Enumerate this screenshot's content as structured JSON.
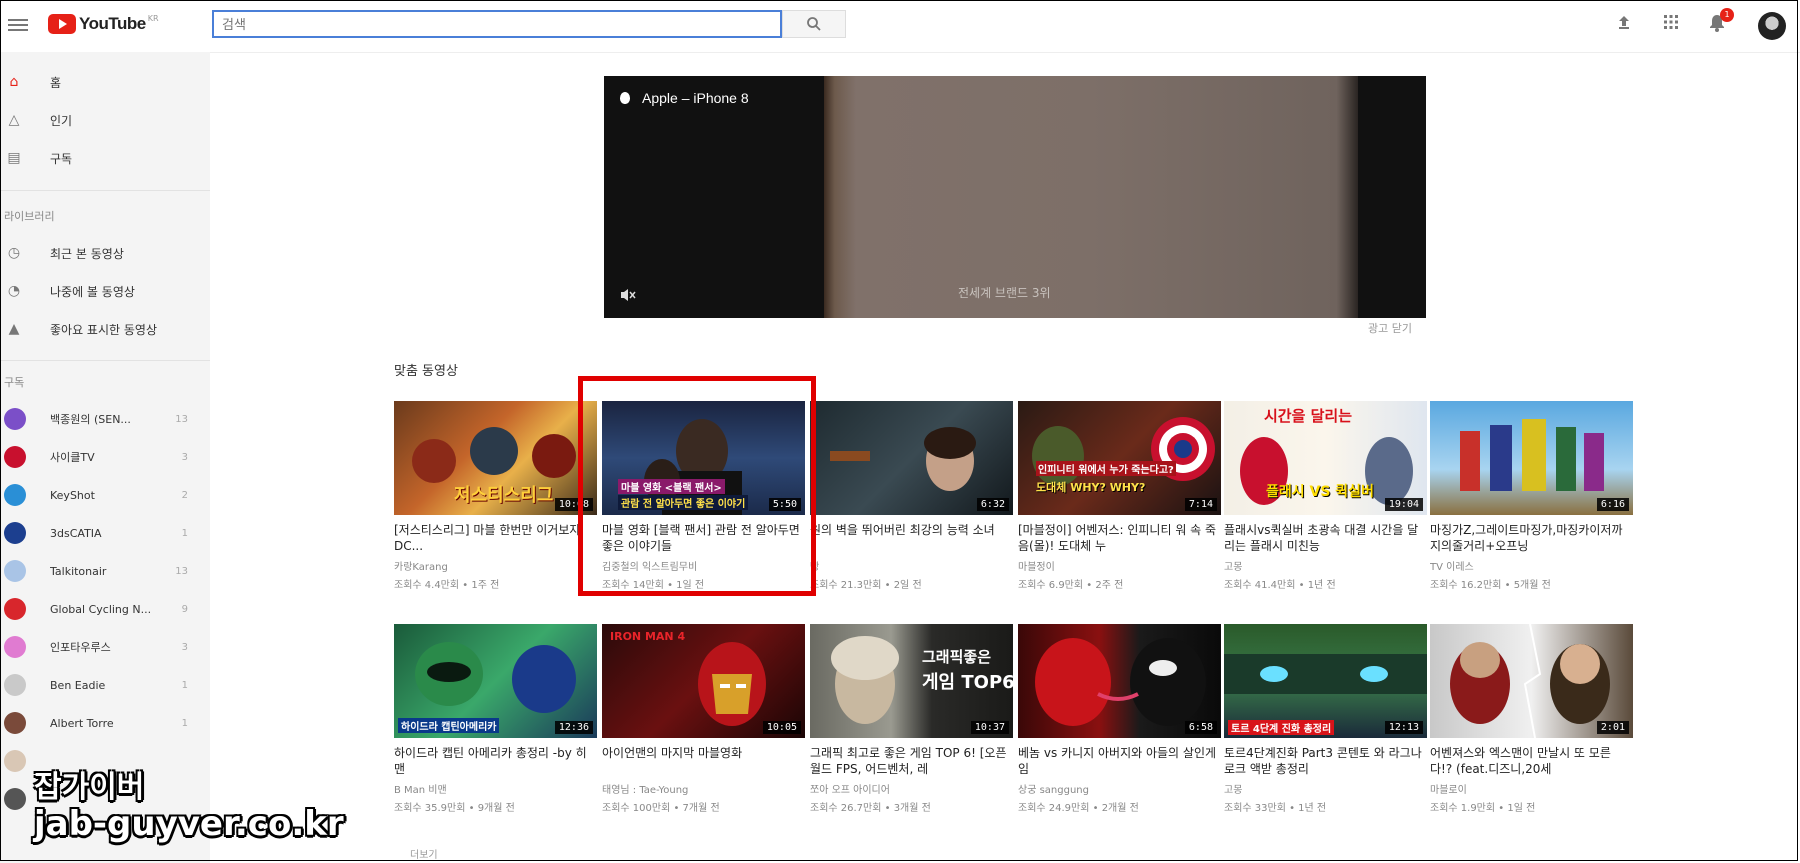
{
  "header": {
    "logo_text": "YouTube",
    "logo_sup": "KR",
    "search_placeholder": "검색",
    "notification_count": "1"
  },
  "sidebar": {
    "main_items": [
      {
        "label": "홈",
        "icon": "home-icon"
      },
      {
        "label": "인기",
        "icon": "fire-icon"
      },
      {
        "label": "구독",
        "icon": "subscriptions-icon"
      }
    ],
    "library_title": "라이브러리",
    "library_items": [
      {
        "label": "최근 본 동영상",
        "icon": "history-icon"
      },
      {
        "label": "나중에 볼 동영상",
        "icon": "clock-icon"
      },
      {
        "label": "좋아요 표시한 동영상",
        "icon": "thumbs-up-icon"
      }
    ],
    "subs_title": "구독",
    "subscriptions": [
      {
        "name": "백종원의 (SEN...",
        "count": "13",
        "color": "#7b4fc8"
      },
      {
        "name": "사이클TV",
        "count": "3",
        "color": "#c8102e"
      },
      {
        "name": "KeyShot",
        "count": "2",
        "color": "#2a8fd6"
      },
      {
        "name": "3dsCATIA",
        "count": "1",
        "color": "#1c3f8f"
      },
      {
        "name": "Talkitonair",
        "count": "13",
        "color": "#a9c4e6"
      },
      {
        "name": "Global Cycling N...",
        "count": "9",
        "color": "#d8262c"
      },
      {
        "name": "인포타우루스",
        "count": "3",
        "color": "#e07bd1"
      },
      {
        "name": "Ben Eadie",
        "count": "1",
        "color": "#c9c9c9"
      },
      {
        "name": "Albert Torre",
        "count": "1",
        "color": "#7a4a3a"
      }
    ]
  },
  "ad": {
    "title": "Apple – iPhone 8",
    "caption": "전세계 브랜드 3위",
    "close_label": "광고 닫기"
  },
  "recommended": {
    "heading": "맞춤 동영상",
    "more_label": "더보기",
    "rows": [
      [
        {
          "title": "[저스티스리그] 마블 한번만 이거보자 DC...",
          "channel": "카랑Karang",
          "meta": "조회수 4.4만회 • 1주 전",
          "duration": "10:08"
        },
        {
          "title": "마블 영화 [블랙 팬서] 관람 전 알아두면 좋은 이야기들",
          "channel": "김중철의 익스트림무비",
          "meta": "조회수 14만회 • 1일 전",
          "duration": "5:50"
        },
        {
          "title": "원의 벽을 뛰어버린 최강의 능력 소녀",
          "channel": "빵",
          "meta": "조회수 21.3만회 • 2일 전",
          "duration": "6:32"
        },
        {
          "title": "[마블정이] 어벤저스: 인피니티 워 속 죽음(몰)! 도대체 누",
          "channel": "마블정이",
          "meta": "조회수 6.9만회 • 2주 전",
          "duration": "7:14"
        },
        {
          "title": "플래시vs퀵실버 초광속 대결 시간을 달리는 플래시 미친능",
          "channel": "고몽",
          "meta": "조회수 41.4만회 • 1년 전",
          "duration": "19:04"
        },
        {
          "title": "마징가Z,그레이트마징가,마징카이저까지의줄거리+오프닝",
          "channel": "TV 이레스",
          "meta": "조회수 16.2만회 • 5개월 전",
          "duration": "6:16"
        }
      ],
      [
        {
          "title": "하이드라 캡틴 아메리카 총정리 -by 히맨",
          "channel": "B Man 비맨",
          "meta": "조회수 35.9만회 • 9개월 전",
          "duration": "12:36"
        },
        {
          "title": "아이언맨의 마지막 마블영화",
          "channel": "태영님 : Tae-Young",
          "meta": "조회수 100만회 • 7개월 전",
          "duration": "10:05"
        },
        {
          "title": "그래픽 최고로 좋은 게임 TOP 6! [오픈월드 FPS, 어드벤처, 레",
          "channel": "쪼아 오프 아이디어",
          "meta": "조회수 26.7만회 • 3개월 전",
          "duration": "10:37"
        },
        {
          "title": "베놈 vs 카니지 아버지와 아들의 살인게임",
          "channel": "상궁 sanggung",
          "meta": "조회수 24.9만회 • 2개월 전",
          "duration": "6:58"
        },
        {
          "title": "토르4단계진화 Part3 콘텐토 와 라그나로크 액받 총정리",
          "channel": "고몽",
          "meta": "조회수 33만회 • 1년 전",
          "duration": "12:13"
        },
        {
          "title": "어벤져스와 엑스맨이 만날시 또 모른다!? (feat.디즈니,20세",
          "channel": "마블로이",
          "meta": "조회수 1.9만회 • 1일 전",
          "duration": "2:01"
        }
      ]
    ],
    "thumb_texts": {
      "r0c0": "저스티스리그",
      "r0c1a": "마블 영화 <블랙 팬서>",
      "r0c1b": "관람 전 알아두면 좋은 이야기",
      "r0c3a": "인피니티 워에서 누가 죽는다고?",
      "r0c3b": "도대체 WHY? WHY?",
      "r0c4a": "시간을 달리는",
      "r0c4b": "플래시 VS 퀵실버",
      "r1c0": "하이드라 캡틴아메리카",
      "r1c1": "IRON MAN 4",
      "r1c2a": "그래픽좋은",
      "r1c2b": "게임 TOP6",
      "r1c4": "토르 4단계 진화 총정리"
    }
  },
  "watermark": {
    "line1": "잡가이버",
    "line2": "jab-guyver.co.kr"
  },
  "colors": {
    "brand_red": "#e62117",
    "highlight": "#e00000",
    "search_border": "#4a7fd8"
  }
}
